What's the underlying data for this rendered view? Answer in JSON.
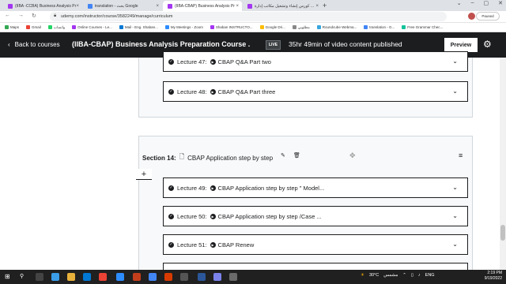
{
  "browser": {
    "tabs": [
      {
        "title": "(IIBA -CCBA) Business Analysis Pr",
        "color": "#a435f0",
        "active": false
      },
      {
        "title": "translation - بحث Google",
        "color": "#4285f4",
        "active": false
      },
      {
        "title": "(IIBA-CBAP) Business Analysis Pr",
        "color": "#a435f0",
        "active": true
      },
      {
        "title": "كورس إنشاء وتشغيل مكاتب إدارة ...",
        "color": "#a435f0",
        "active": false
      }
    ],
    "url": "udemy.com/instructor/course/3582249/manage/curriculum",
    "paused_label": "Paused",
    "bookmarks": [
      {
        "label": "Maps",
        "color": "#34a853"
      },
      {
        "label": "Gmail",
        "color": "#ea4335"
      },
      {
        "label": "واتساب",
        "color": "#25d366"
      },
      {
        "label": "Online Courses - Le...",
        "color": "#a435f0"
      },
      {
        "label": "Mail - Eng. Shaban...",
        "color": "#0078d4"
      },
      {
        "label": "My Meetings - Zoom",
        "color": "#2d8cff"
      },
      {
        "label": "Shaban INSTRUCTO...",
        "color": "#a435f0"
      },
      {
        "label": "Google Dri...",
        "color": "#fbbc04"
      },
      {
        "label": "مطلوبي",
        "color": "#888888"
      },
      {
        "label": "Roundcube Webma...",
        "color": "#37a6de"
      },
      {
        "label": "translation - G...",
        "color": "#4285f4"
      },
      {
        "label": "Free Grammar Chec...",
        "color": "#15c39a"
      }
    ]
  },
  "header": {
    "back_label": "Back to courses",
    "course_title": "(IIBA-CBAP) Business Analysis Preparation Course .",
    "live_badge": "LIVE",
    "published_text": "35hr 49min of video content published",
    "preview_label": "Preview"
  },
  "section13": {
    "lectures": [
      {
        "label": "Lecture 47:",
        "title": "CBAP Q&A Part two"
      },
      {
        "label": "Lecture 48:",
        "title": "CBAP Q&A Part three"
      }
    ]
  },
  "section14": {
    "label": "Section 14:",
    "title": "CBAP Application step by step",
    "lectures": [
      {
        "label": "Lecture 49:",
        "title": "CBAP Application step by step \" Model..."
      },
      {
        "label": "Lecture 50:",
        "title": "CBAP Application step by step /Case ..."
      },
      {
        "label": "Lecture 51:",
        "title": "CBAP Renew"
      }
    ]
  },
  "taskbar": {
    "temperature": "30°C",
    "weather": "مشمس",
    "language": "ENG",
    "time": "2:19 PM",
    "date": "9/19/2022"
  }
}
